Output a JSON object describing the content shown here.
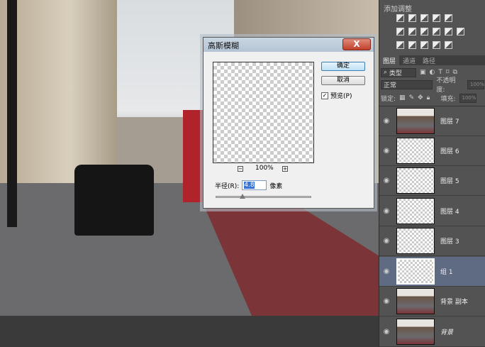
{
  "dialog": {
    "title": "高斯模糊",
    "close": "X",
    "ok": "确定",
    "cancel": "取消",
    "preview_label": "预览(P)",
    "preview_checked": true,
    "zoom_out": "−",
    "zoom_in": "+",
    "zoom_level": "100%",
    "radius_label": "半径(R):",
    "radius_value": "4.8",
    "radius_unit": "像素"
  },
  "panel": {
    "adjust_title": "添加调整",
    "tabs": [
      "图层",
      "通道",
      "路径"
    ],
    "filter_kind": "类型",
    "blend_mode": "正常",
    "opacity_label": "不透明度:",
    "opacity_value": "100%",
    "lock_label": "锁定:",
    "fill_label": "填充:",
    "fill_value": "100%",
    "layers": [
      {
        "name": "图层 7",
        "thumb": "photo"
      },
      {
        "name": "图层 6",
        "thumb": "transparent"
      },
      {
        "name": "图层 5",
        "thumb": "transparent"
      },
      {
        "name": "图层 4",
        "thumb": "transparent"
      },
      {
        "name": "图层 3",
        "thumb": "transparent"
      },
      {
        "name": "组 1",
        "thumb": "transparent",
        "selected": true
      },
      {
        "name": "背景 副本",
        "thumb": "photo"
      },
      {
        "name": "背景",
        "thumb": "photo"
      }
    ]
  },
  "colors": {
    "bus_lane": "#7b3438",
    "selected_layer": "#5e6b82",
    "panel_bg": "#535353"
  }
}
